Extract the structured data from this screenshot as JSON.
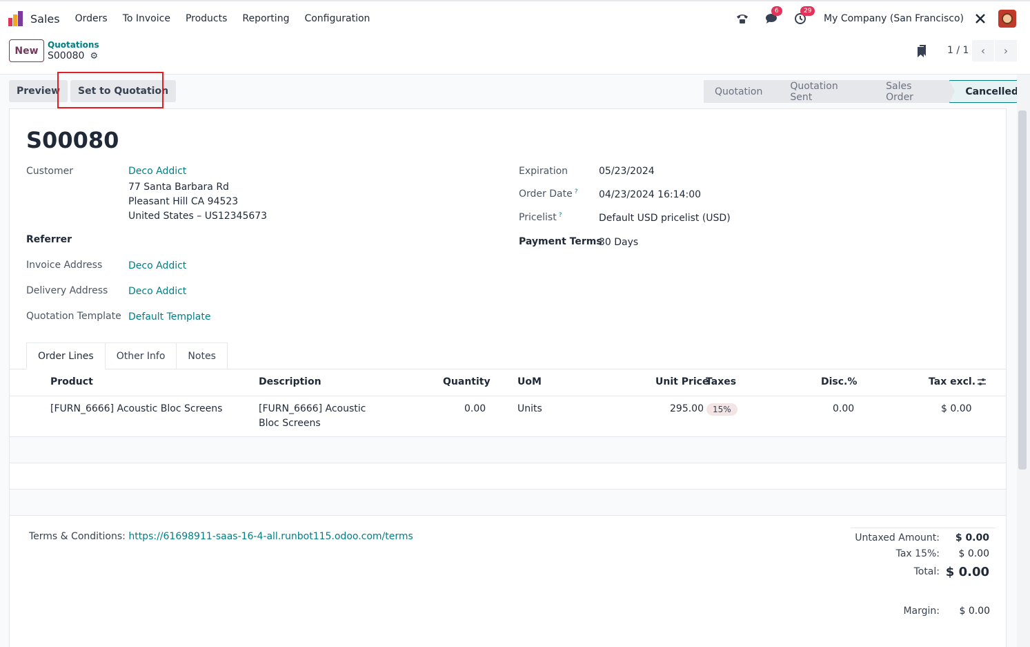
{
  "app": {
    "name": "Sales"
  },
  "menu": [
    "Orders",
    "To Invoice",
    "Products",
    "Reporting",
    "Configuration"
  ],
  "systray": {
    "chat_badge": "6",
    "activity_badge": "29",
    "company": "My Company (San Francisco)"
  },
  "control": {
    "new_label": "New",
    "breadcrumb_parent": "Quotations",
    "breadcrumb_current": "S00080",
    "pager": "1 / 1"
  },
  "actions": {
    "preview": "Preview",
    "set_to_quotation": "Set to Quotation"
  },
  "stages": [
    "Quotation",
    "Quotation Sent",
    "Sales Order",
    "Cancelled"
  ],
  "order": {
    "name": "S00080",
    "labels": {
      "customer": "Customer",
      "referrer": "Referrer",
      "invoice_address": "Invoice Address",
      "delivery_address": "Delivery Address",
      "quotation_template": "Quotation Template",
      "expiration": "Expiration",
      "order_date": "Order Date",
      "pricelist": "Pricelist",
      "payment_terms": "Payment Terms"
    },
    "customer": "Deco Addict",
    "address_1": "77 Santa Barbara Rd",
    "address_2": "Pleasant Hill CA 94523",
    "address_3": "United States – US12345673",
    "invoice_address": "Deco Addict",
    "delivery_address": "Deco Addict",
    "quotation_template": "Default Template",
    "expiration": "05/23/2024",
    "order_date": "04/23/2024 16:14:00",
    "pricelist": "Default USD pricelist (USD)",
    "payment_terms": "30 Days",
    "help_mark": "?"
  },
  "tabs": [
    "Order Lines",
    "Other Info",
    "Notes"
  ],
  "table": {
    "headers": {
      "product": "Product",
      "description": "Description",
      "quantity": "Quantity",
      "uom": "UoM",
      "unit_price": "Unit Price",
      "taxes": "Taxes",
      "disc": "Disc.%",
      "tax_excl": "Tax excl."
    },
    "row": {
      "product": "[FURN_6666] Acoustic Bloc Screens",
      "description_1": "[FURN_6666] Acoustic",
      "description_2": "Bloc Screens",
      "quantity": "0.00",
      "uom": "Units",
      "unit_price": "295.00",
      "taxes": "15%",
      "disc": "0.00",
      "tax_excl": "$ 0.00"
    }
  },
  "terms": {
    "label": "Terms & Conditions:",
    "url": "https://61698911-saas-16-4-all.runbot115.odoo.com/terms"
  },
  "totals": {
    "untaxed_label": "Untaxed Amount:",
    "untaxed": "$ 0.00",
    "tax_label": "Tax 15%:",
    "tax": "$ 0.00",
    "total_label": "Total:",
    "total": "$ 0.00",
    "margin_label": "Margin:",
    "margin": "$ 0.00"
  },
  "colors": {
    "accent": "#017e84",
    "brand": "#71385b",
    "highlight": "#e11d26"
  }
}
